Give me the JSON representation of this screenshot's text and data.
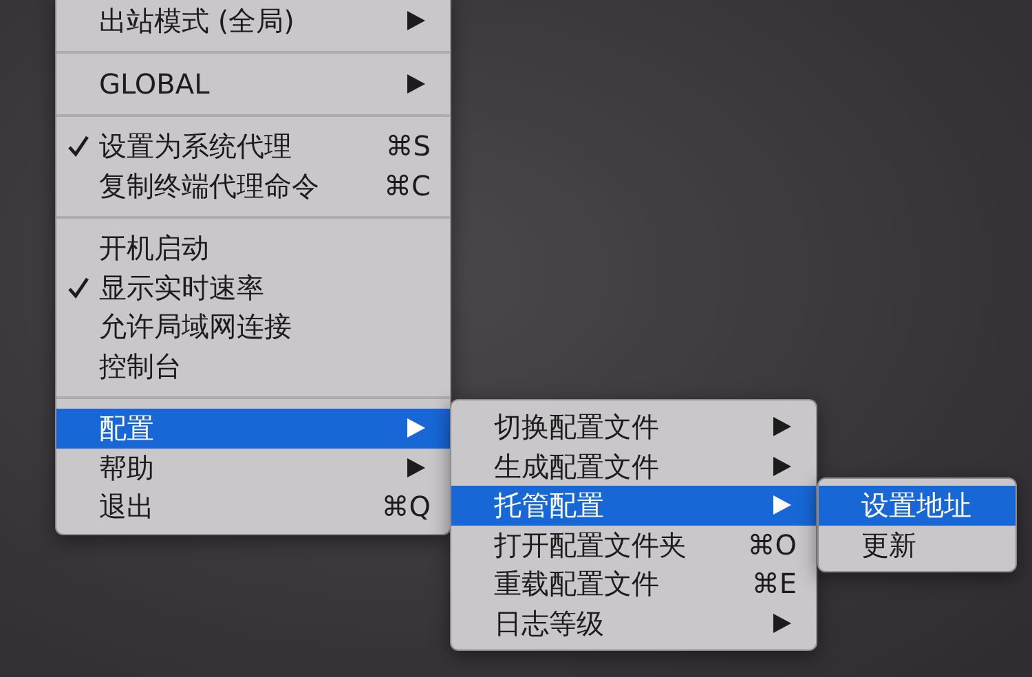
{
  "menus": [
    {
      "items": [
        {
          "kind": "item",
          "label": "出站模式 (全局)",
          "checked": false,
          "selected": false,
          "has_submenu": true
        },
        {
          "kind": "separator"
        },
        {
          "kind": "item",
          "label": "GLOBAL",
          "checked": false,
          "selected": false,
          "has_submenu": true
        },
        {
          "kind": "separator"
        },
        {
          "kind": "item",
          "label": "设置为系统代理",
          "checked": true,
          "selected": false,
          "has_submenu": false,
          "shortcut": "⌘S"
        },
        {
          "kind": "item",
          "label": "复制终端代理命令",
          "checked": false,
          "selected": false,
          "has_submenu": false,
          "shortcut": "⌘C"
        },
        {
          "kind": "separator"
        },
        {
          "kind": "item",
          "label": "开机启动",
          "checked": false,
          "selected": false,
          "has_submenu": false
        },
        {
          "kind": "item",
          "label": "显示实时速率",
          "checked": true,
          "selected": false,
          "has_submenu": false
        },
        {
          "kind": "item",
          "label": "允许局域网连接",
          "checked": false,
          "selected": false,
          "has_submenu": false
        },
        {
          "kind": "item",
          "label": "控制台",
          "checked": false,
          "selected": false,
          "has_submenu": false
        },
        {
          "kind": "separator"
        },
        {
          "kind": "item",
          "label": "配置",
          "checked": false,
          "selected": true,
          "has_submenu": true
        },
        {
          "kind": "item",
          "label": "帮助",
          "checked": false,
          "selected": false,
          "has_submenu": true
        },
        {
          "kind": "item",
          "label": "退出",
          "checked": false,
          "selected": false,
          "has_submenu": false,
          "shortcut": "⌘Q"
        }
      ]
    },
    {
      "items": [
        {
          "kind": "item",
          "label": "切换配置文件",
          "checked": false,
          "selected": false,
          "has_submenu": true
        },
        {
          "kind": "item",
          "label": "生成配置文件",
          "checked": false,
          "selected": false,
          "has_submenu": true
        },
        {
          "kind": "item",
          "label": "托管配置",
          "checked": false,
          "selected": true,
          "has_submenu": true
        },
        {
          "kind": "item",
          "label": "打开配置文件夹",
          "checked": false,
          "selected": false,
          "has_submenu": false,
          "shortcut": "⌘O"
        },
        {
          "kind": "item",
          "label": "重载配置文件",
          "checked": false,
          "selected": false,
          "has_submenu": false,
          "shortcut": "⌘E"
        },
        {
          "kind": "item",
          "label": "日志等级",
          "checked": false,
          "selected": false,
          "has_submenu": true
        }
      ]
    },
    {
      "items": [
        {
          "kind": "item",
          "label": "设置地址",
          "checked": false,
          "selected": true,
          "has_submenu": false
        },
        {
          "kind": "item",
          "label": "更新",
          "checked": false,
          "selected": false,
          "has_submenu": false
        }
      ]
    }
  ]
}
